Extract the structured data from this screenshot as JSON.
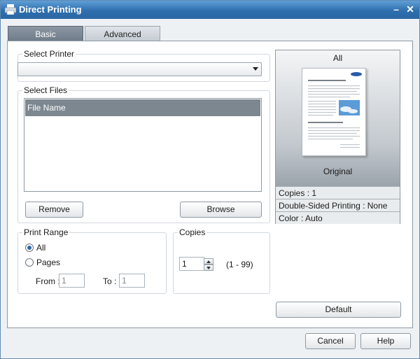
{
  "window": {
    "title": "Direct Printing",
    "min_glyph": "–",
    "close_glyph": "✕"
  },
  "tabs": [
    {
      "label": "Basic"
    },
    {
      "label": "Advanced"
    }
  ],
  "select_printer": {
    "label": "Select Printer",
    "value": ""
  },
  "select_files": {
    "label": "Select Files",
    "column_header": "File Name",
    "remove_label": "Remove",
    "browse_label": "Browse"
  },
  "print_range": {
    "label": "Print Range",
    "all_label": "All",
    "pages_label": "Pages",
    "from_label": "From :",
    "from_value": "1",
    "to_label": "To :",
    "to_value": "1",
    "selected": "All"
  },
  "copies": {
    "label": "Copies",
    "value": "1",
    "range_label": "(1 - 99)"
  },
  "preview": {
    "title": "All",
    "caption": "Original",
    "copies": "Copies : 1",
    "duplex": "Double-Sided Printing : None",
    "color": "Color : Auto"
  },
  "default_label": "Default",
  "footer": {
    "cancel_label": "Cancel",
    "help_label": "Help"
  },
  "colors": {
    "titlebar": "#2f6fae",
    "accent": "#2a66a3",
    "header_gray": "#7d8790"
  }
}
